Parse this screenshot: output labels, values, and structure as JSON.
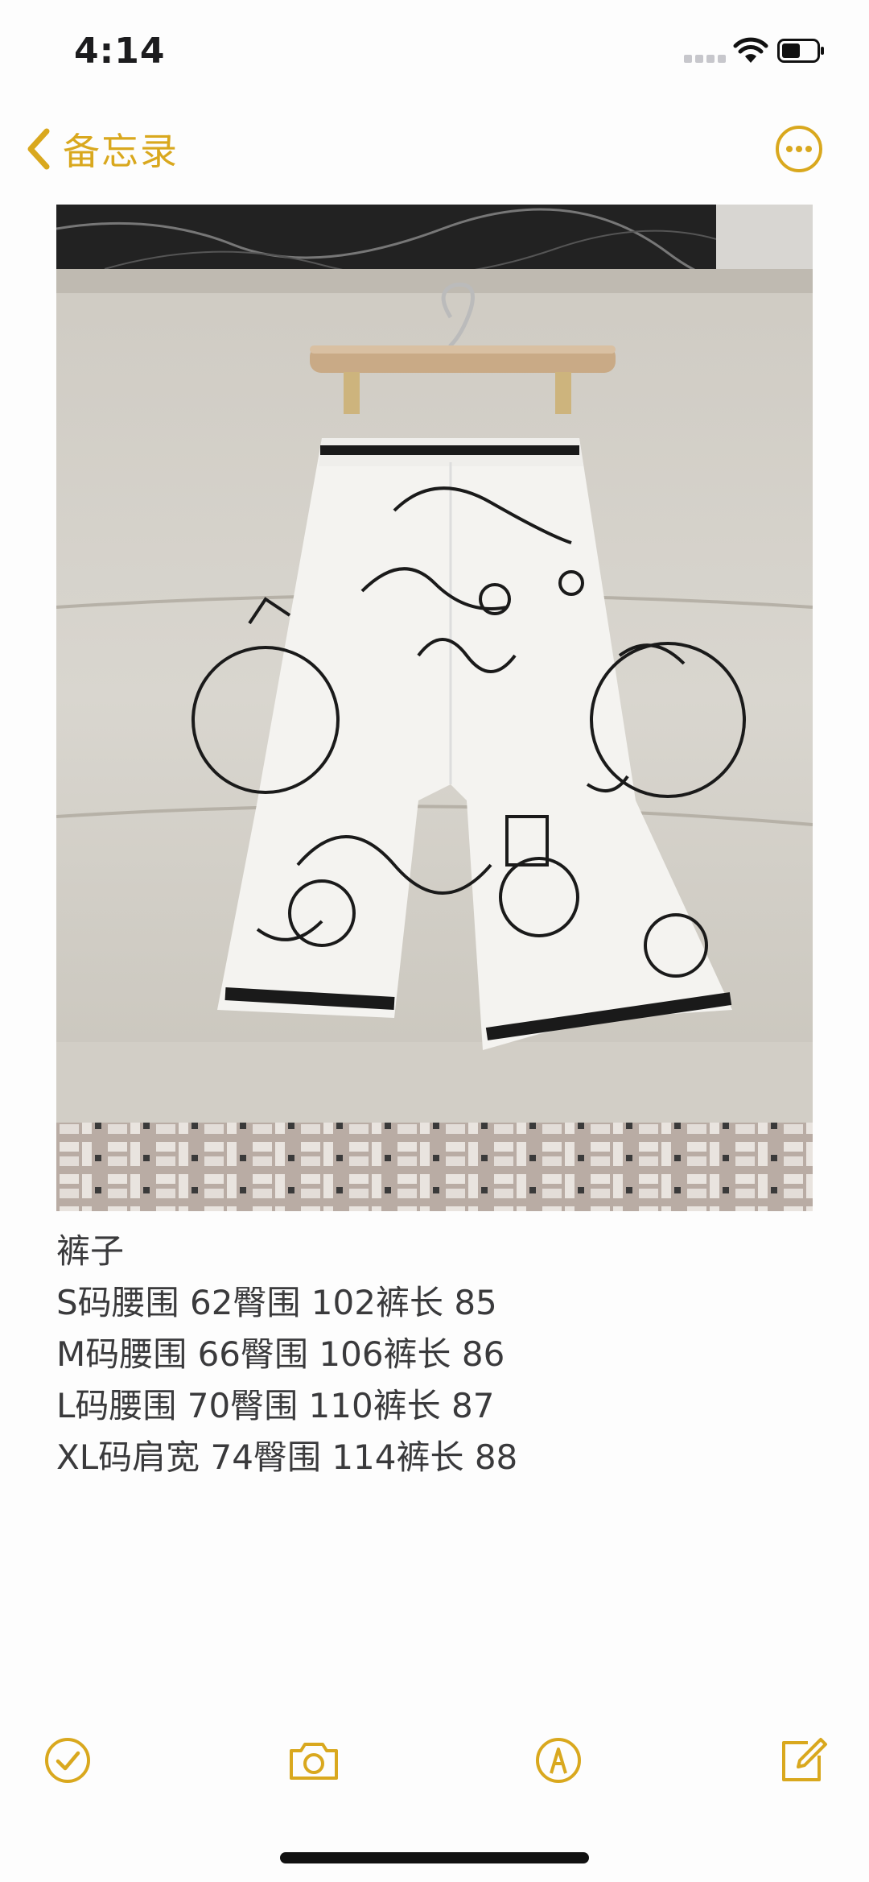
{
  "status_bar": {
    "time": "4:14",
    "icons": [
      "cellular-signal-icon",
      "wifi-icon",
      "battery-icon"
    ]
  },
  "nav": {
    "back_label": "备忘录",
    "back_icon": "chevron-left-icon",
    "more_icon": "ellipsis-circle-icon"
  },
  "note": {
    "image_subject": "white wide-leg trousers with black line-art carriage print on a hanger",
    "lines": [
      "裤子",
      "S码腰围 62臀围 102裤长 85",
      "M码腰围 66臀围 106裤长 86",
      "L码腰围 70臀围 110裤长 87",
      "XL码肩宽 74臀围 114裤长 88"
    ]
  },
  "toolbar": {
    "icons": [
      "checklist-icon",
      "camera-icon",
      "markup-pen-icon",
      "compose-icon"
    ]
  },
  "colors": {
    "accent": "#d9a81e",
    "text": "#3a3a3c",
    "background": "#fdfdfd"
  }
}
